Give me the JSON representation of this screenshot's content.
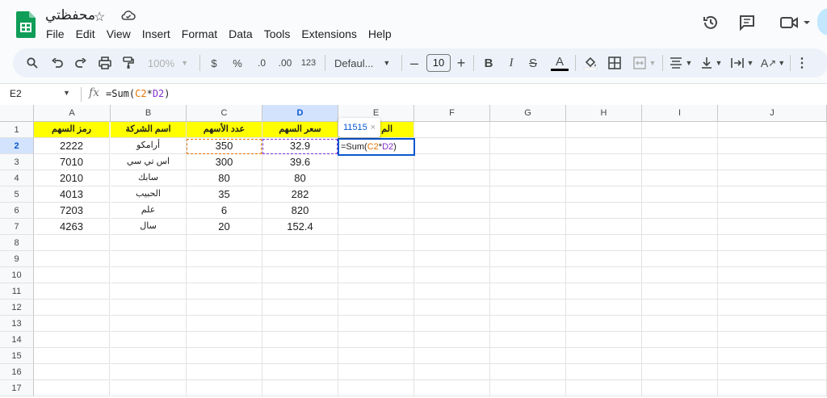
{
  "app": {
    "doc_title": "محفظتي",
    "menu": [
      "File",
      "Edit",
      "View",
      "Insert",
      "Format",
      "Data",
      "Tools",
      "Extensions",
      "Help"
    ]
  },
  "toolbar": {
    "zoom": "100%",
    "currency": "$",
    "percent": "%",
    "decrease_decimal": ".0",
    "increase_decimal": ".00",
    "more_formats": "123",
    "font": "Defaul...",
    "font_size": "10",
    "bold": "B",
    "italic": "I",
    "text_color_letter": "A",
    "text_color": "#000000"
  },
  "formula_bar": {
    "name_box": "E2",
    "fx": "fx",
    "formula_prefix": "=Sum(",
    "ref1": "C2",
    "op": "*",
    "ref2": "D2",
    "formula_suffix": ")"
  },
  "sheet": {
    "columns": [
      "A",
      "B",
      "C",
      "D",
      "E",
      "F",
      "G",
      "H",
      "I",
      "J"
    ],
    "selected_column": "D",
    "rows": [
      "1",
      "2",
      "3",
      "4",
      "5",
      "6",
      "7",
      "8",
      "9",
      "10",
      "11",
      "12",
      "13",
      "14",
      "15",
      "16",
      "17"
    ],
    "header_row": [
      "رمز السهم",
      "اسم الشركة",
      "عدد الأسهم",
      "سعر السهم",
      "الم"
    ],
    "data": [
      [
        "2222",
        "أرامكو",
        "350",
        "32.9"
      ],
      [
        "7010",
        "اس تي سي",
        "300",
        "39.6"
      ],
      [
        "2010",
        "سابك",
        "80",
        "80"
      ],
      [
        "4013",
        "الحبيب",
        "35",
        "282"
      ],
      [
        "7203",
        "علم",
        "6",
        "820"
      ],
      [
        "4263",
        "سال",
        "20",
        "152.4"
      ]
    ],
    "active_cell": "E2",
    "preview_value": "11515",
    "preview_close": "×",
    "header_fill": "#ffff00"
  },
  "colors": {
    "accent": "#0b57d0",
    "ref_c": "#e37400",
    "ref_d": "#8430ce"
  }
}
